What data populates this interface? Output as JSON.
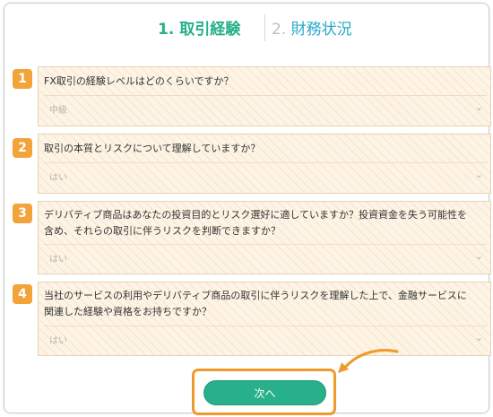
{
  "steps": {
    "step1": "1. 取引経験",
    "step2_num": "2.",
    "step2_label": "財務状況"
  },
  "questions": [
    {
      "number": "1",
      "line1": "FX取引の経験レベルはどのくらいですか？",
      "line2": "",
      "select_value": "中級"
    },
    {
      "number": "2",
      "line1": "取引の本質とリスクについて理解していますか？",
      "line2": "",
      "select_value": "はい"
    },
    {
      "number": "3",
      "line1": "デリバティブ商品はあなたの投資目的とリスク選好に適していますか？投資資金を失う可能性を",
      "line2": "含め、それらの取引に伴うリスクを判断できますか？",
      "select_value": "はい"
    },
    {
      "number": "4",
      "line1": "当社のサービスの利用やデリバティブ商品の取引に伴うリスクを理解した上で、金融サービスに",
      "line2": "関連した経験や資格をお持ちですか？",
      "select_value": "はい"
    }
  ],
  "next_button": "次へ",
  "colors": {
    "accent_green": "#27b08a",
    "accent_orange": "#f2a33a",
    "step2_blue": "#2aa8c8"
  },
  "icons": {
    "dropdown": "chevron-down-icon",
    "pointer": "curved-arrow-icon"
  }
}
